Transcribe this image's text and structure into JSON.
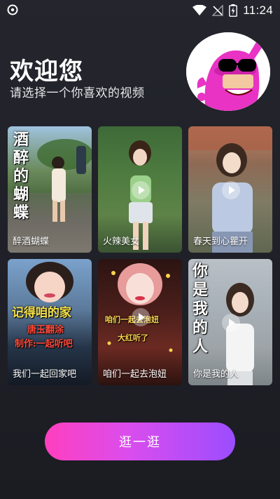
{
  "status_bar": {
    "time": "11:24"
  },
  "header": {
    "title": "欢迎您",
    "subtitle": "请选择一个你喜欢的视频"
  },
  "avatar": {
    "icon": "cartoon-character-icon"
  },
  "videos": [
    {
      "caption": "醉酒蝴蝶",
      "overlay": "酒醉的蝴蝶"
    },
    {
      "caption": "火辣美女"
    },
    {
      "caption": "春天到心瞿开"
    },
    {
      "caption": "我们一起回家吧",
      "overlay_lines": [
        "记得咱的家",
        "唐玉翻涂",
        "制作:一起听吧"
      ]
    },
    {
      "caption": "咱们一起去泡妞",
      "overlay_lines": [
        "咱们一起去泡妞",
        "大红听了"
      ]
    },
    {
      "caption": "你是我的人",
      "overlay": "你是我的人"
    }
  ],
  "action": {
    "label": "逛一逛"
  },
  "colors": {
    "button_start": "#ff3fbf",
    "button_end": "#9b4dff",
    "background": "#24252d"
  }
}
